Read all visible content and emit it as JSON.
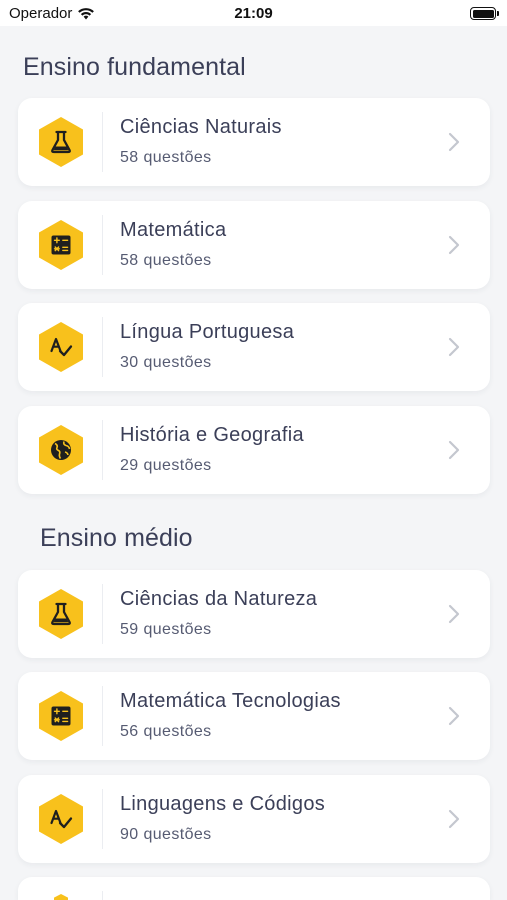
{
  "status_bar": {
    "carrier": "Operador",
    "time": "21:09"
  },
  "colors": {
    "accent": "#f8c11c",
    "icon_dark": "#1f1f1f",
    "background": "#f4f5f7"
  },
  "sections": [
    {
      "title": "Ensino fundamental",
      "items": [
        {
          "title": "Ciências Naturais",
          "subtitle": "58 questões",
          "icon": "flask-icon"
        },
        {
          "title": "Matemática",
          "subtitle": "58 questões",
          "icon": "calculator-icon"
        },
        {
          "title": "Língua Portuguesa",
          "subtitle": "30 questões",
          "icon": "spellcheck-icon"
        },
        {
          "title": "História e Geografia",
          "subtitle": "29 questões",
          "icon": "globe-icon"
        }
      ]
    },
    {
      "title": "Ensino médio",
      "items": [
        {
          "title": "Ciências da Natureza",
          "subtitle": "59 questões",
          "icon": "flask-icon"
        },
        {
          "title": "Matemática Tecnologias",
          "subtitle": "56 questões",
          "icon": "calculator-icon"
        },
        {
          "title": "Linguagens e Códigos",
          "subtitle": "90 questões",
          "icon": "spellcheck-icon"
        },
        {
          "title": "",
          "subtitle": "",
          "icon": "spellcheck-icon"
        }
      ]
    }
  ]
}
